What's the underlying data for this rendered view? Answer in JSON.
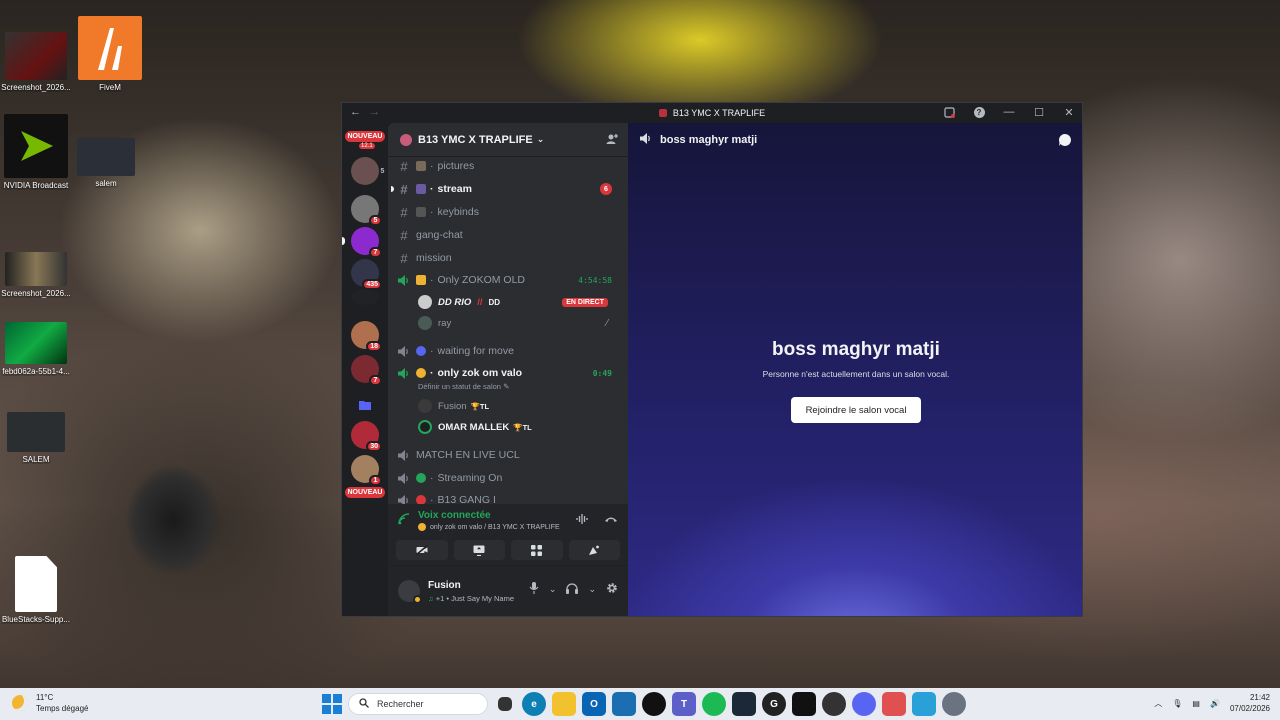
{
  "desktop": {
    "icons": [
      {
        "label": "Screenshot_2026..."
      },
      {
        "label": "FiveM"
      },
      {
        "label": "NVIDIA Broadcast"
      },
      {
        "label": "salem"
      },
      {
        "label": "Screenshot_2026..."
      },
      {
        "label": "febd062a-55b1-4..."
      },
      {
        "label": "SALEM"
      },
      {
        "label": "BlueStacks-Supp..."
      }
    ]
  },
  "window": {
    "title": "B13 YMC X TRAPLIFE",
    "back": "←",
    "forward": "→",
    "minimize": "—",
    "maximize": "☐",
    "close": "✕",
    "help": "?"
  },
  "guilds": {
    "nouveau_top": "NOUVEAU",
    "top_small_badge": "12.1",
    "items": [
      {
        "badge": "5"
      },
      {
        "badge": "5"
      },
      {
        "badge": "7"
      },
      {
        "badge": "435"
      },
      {
        "badge": ""
      },
      {
        "badge": "18"
      },
      {
        "badge": "7"
      },
      {
        "badge": ""
      },
      {
        "badge": "30"
      },
      {
        "badge": "1"
      }
    ],
    "nouveau_bottom": "NOUVEAU"
  },
  "server": {
    "name": "B13 YMC X TRAPLIFE",
    "channels": [
      {
        "name": "pictures",
        "type": "text"
      },
      {
        "name": "stream",
        "type": "text",
        "unread_count": "6"
      },
      {
        "name": "keybinds",
        "type": "text"
      },
      {
        "name": "gang-chat",
        "type": "text"
      },
      {
        "name": "mission",
        "type": "text"
      },
      {
        "name": "Only ZOKOM OLD",
        "type": "voice",
        "timer": "4:54:58"
      },
      {
        "name": "waiting for move",
        "type": "voice"
      },
      {
        "name": "only zok om valo",
        "type": "voice",
        "timer": "0:49",
        "status_prompt": "Définir un statut de salon"
      },
      {
        "name": "MATCH EN LIVE UCL",
        "type": "voice"
      },
      {
        "name": "Streaming On",
        "type": "voice"
      },
      {
        "name": "B13 GANG I",
        "type": "voice"
      }
    ],
    "voice_users_zokom": [
      {
        "name": "DD RIO",
        "extra": "DD",
        "live": "EN DIRECT"
      },
      {
        "name": "ray"
      }
    ],
    "voice_users_valo": [
      {
        "name": "Fusion",
        "tag": "TL"
      },
      {
        "name": "OMAR MALLEK",
        "tag": "TL"
      }
    ]
  },
  "voice_panel": {
    "title": "Voix connectée",
    "subtitle": "only zok om valo / B13 YMC X TRAPLIFE"
  },
  "user_panel": {
    "name": "Fusion",
    "status": "+1 • Just Say My Name"
  },
  "main": {
    "channel": "boss maghyr matji",
    "title": "boss maghyr matji",
    "subtitle": "Personne n'est actuellement dans un salon vocal.",
    "join_label": "Rejoindre le salon vocal"
  },
  "taskbar": {
    "temp": "11°C",
    "weather": "Temps dégagé",
    "search_placeholder": "Rechercher",
    "time": "21:42",
    "date": "07/02/2026"
  },
  "colors": {
    "discord_bg": "#1e1f22",
    "sidebar_bg": "#2b2d31",
    "accent_green": "#23a55a",
    "accent_red": "#da373c"
  }
}
